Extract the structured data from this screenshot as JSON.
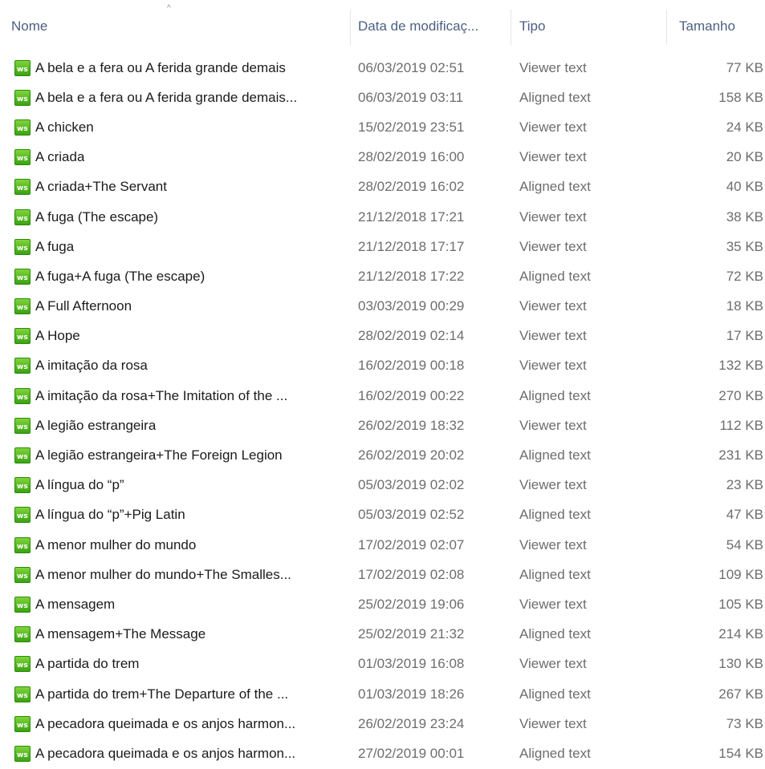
{
  "columns": {
    "name": "Nome",
    "date": "Data de modificaç...",
    "type": "Tipo",
    "size": "Tamanho"
  },
  "sort_indicator": "^",
  "file_icon": {
    "name": "ws-file-icon",
    "glyph": "ws",
    "color": "#4cb81e"
  },
  "files": [
    {
      "name": "A bela e a fera ou A ferida grande demais",
      "date": "06/03/2019 02:51",
      "type": "Viewer text",
      "size": "77 KB"
    },
    {
      "name": "A bela e a fera ou A ferida grande demais...",
      "date": "06/03/2019 03:11",
      "type": "Aligned text",
      "size": "158 KB"
    },
    {
      "name": "A chicken",
      "date": "15/02/2019 23:51",
      "type": "Viewer text",
      "size": "24 KB"
    },
    {
      "name": "A criada",
      "date": "28/02/2019 16:00",
      "type": "Viewer text",
      "size": "20 KB"
    },
    {
      "name": "A criada+The Servant",
      "date": "28/02/2019 16:02",
      "type": "Aligned text",
      "size": "40 KB"
    },
    {
      "name": "A fuga (The escape)",
      "date": "21/12/2018 17:21",
      "type": "Viewer text",
      "size": "38 KB"
    },
    {
      "name": "A fuga",
      "date": "21/12/2018 17:17",
      "type": "Viewer text",
      "size": "35 KB"
    },
    {
      "name": "A fuga+A fuga (The escape)",
      "date": "21/12/2018 17:22",
      "type": "Aligned text",
      "size": "72 KB"
    },
    {
      "name": "A Full Afternoon",
      "date": "03/03/2019 00:29",
      "type": "Viewer text",
      "size": "18 KB"
    },
    {
      "name": "A Hope",
      "date": "28/02/2019 02:14",
      "type": "Viewer text",
      "size": "17 KB"
    },
    {
      "name": "A imitação da rosa",
      "date": "16/02/2019 00:18",
      "type": "Viewer text",
      "size": "132 KB"
    },
    {
      "name": "A imitação da rosa+The Imitation of the ...",
      "date": "16/02/2019 00:22",
      "type": "Aligned text",
      "size": "270 KB"
    },
    {
      "name": "A legião estrangeira",
      "date": "26/02/2019 18:32",
      "type": "Viewer text",
      "size": "112 KB"
    },
    {
      "name": "A legião estrangeira+The Foreign Legion",
      "date": "26/02/2019 20:02",
      "type": "Aligned text",
      "size": "231 KB"
    },
    {
      "name": "A língua do “p”",
      "date": "05/03/2019 02:02",
      "type": "Viewer text",
      "size": "23 KB"
    },
    {
      "name": "A língua do “p”+Pig Latin",
      "date": "05/03/2019 02:52",
      "type": "Aligned text",
      "size": "47 KB"
    },
    {
      "name": "A menor mulher do mundo",
      "date": "17/02/2019 02:07",
      "type": "Viewer text",
      "size": "54 KB"
    },
    {
      "name": "A menor mulher do mundo+The Smalles...",
      "date": "17/02/2019 02:08",
      "type": "Aligned text",
      "size": "109 KB"
    },
    {
      "name": "A mensagem",
      "date": "25/02/2019 19:06",
      "type": "Viewer text",
      "size": "105 KB"
    },
    {
      "name": "A mensagem+The Message",
      "date": "25/02/2019 21:32",
      "type": "Aligned text",
      "size": "214 KB"
    },
    {
      "name": "A partida do trem",
      "date": "01/03/2019 16:08",
      "type": "Viewer text",
      "size": "130 KB"
    },
    {
      "name": "A partida do trem+The Departure of the ...",
      "date": "01/03/2019 18:26",
      "type": "Aligned text",
      "size": "267 KB"
    },
    {
      "name": "A pecadora queimada e os anjos harmon...",
      "date": "26/02/2019 23:24",
      "type": "Viewer text",
      "size": "73 KB"
    },
    {
      "name": "A pecadora queimada e os anjos harmon...",
      "date": "27/02/2019 00:01",
      "type": "Aligned text",
      "size": "154 KB"
    }
  ]
}
